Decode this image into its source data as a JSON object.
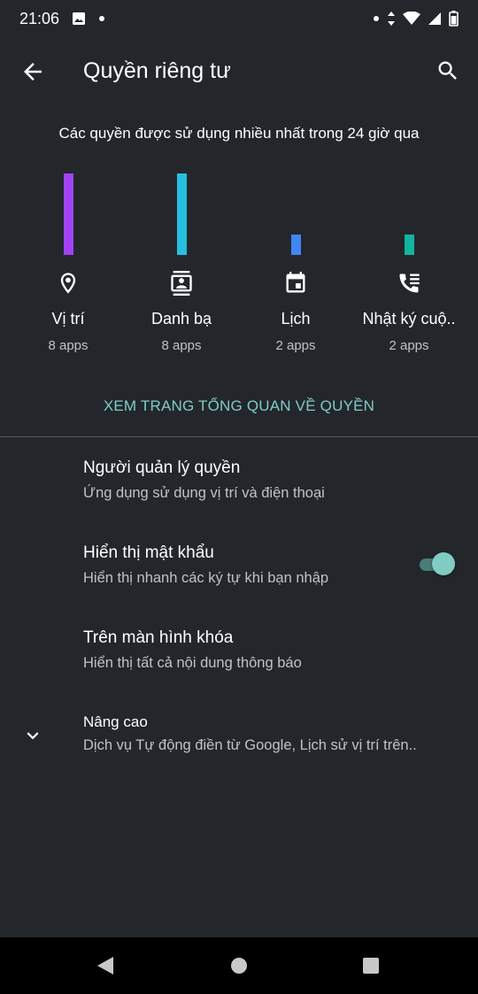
{
  "status": {
    "time": "21:06"
  },
  "header": {
    "title": "Quyền riêng tư"
  },
  "usage": {
    "subtitle": "Các quyền được sử dụng nhiều nhất trong 24 giờ qua",
    "items": [
      {
        "label": "Vị trí",
        "count": "8 apps",
        "level": 1.0,
        "color": "#a142f4",
        "icon": "location-pin-icon"
      },
      {
        "label": "Danh bạ",
        "count": "8 apps",
        "level": 1.0,
        "color": "#24c1e0",
        "icon": "contacts-icon"
      },
      {
        "label": "Lịch",
        "count": "2 apps",
        "level": 0.25,
        "color": "#4285f4",
        "icon": "calendar-icon"
      },
      {
        "label": "Nhật ký cuộ..",
        "count": "2 apps",
        "level": 0.25,
        "color": "#12b5a0",
        "icon": "call-log-icon"
      }
    ]
  },
  "overview_link": "XEM TRANG TỔNG QUAN VỀ QUYỀN",
  "settings": [
    {
      "title": "Người quản lý quyền",
      "subtitle": "Ứng dụng sử dụng vị trí và điện thoại"
    },
    {
      "title": "Hiển thị mật khẩu",
      "subtitle": "Hiển thị nhanh các ký tự khi bạn nhập",
      "toggle_on": true
    },
    {
      "title": "Trên màn hình khóa",
      "subtitle": "Hiển thị tất cả nội dung thông báo"
    },
    {
      "title": "Nâng cao",
      "subtitle": "Dịch vụ Tự động điền từ Google, Lịch sử vị trí trên.."
    }
  ],
  "colors": {
    "background": "#23272c",
    "accent": "#80cbc4",
    "nav_bar": "#000000"
  }
}
